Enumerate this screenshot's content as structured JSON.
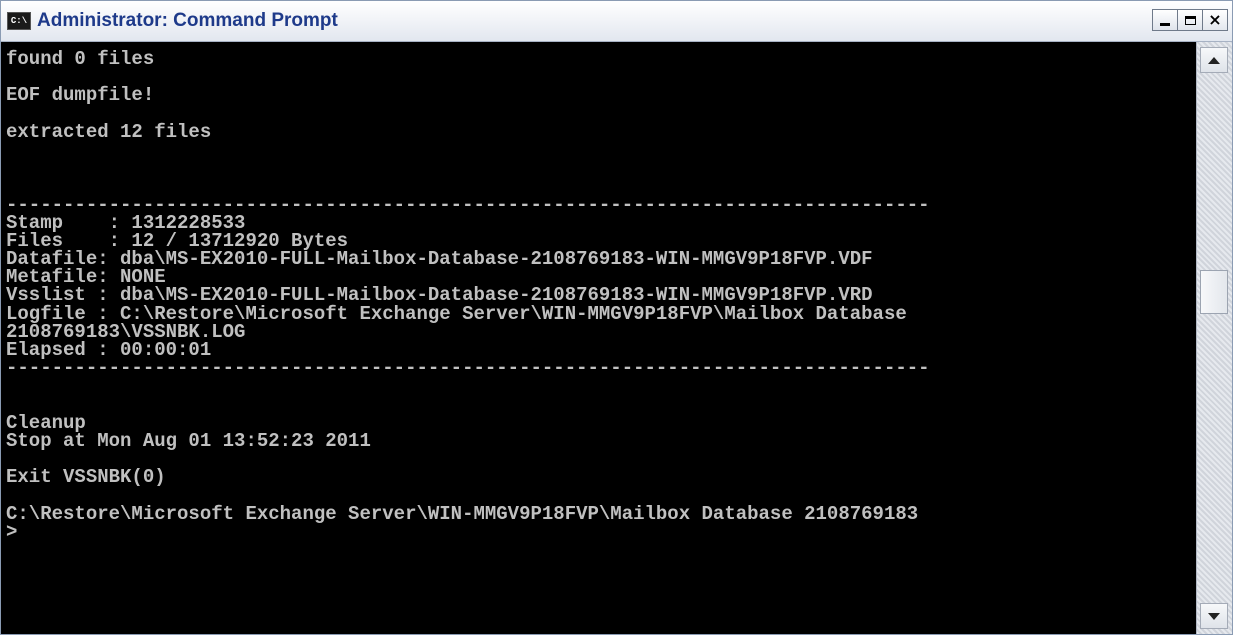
{
  "window": {
    "title": "Administrator: Command Prompt",
    "app_icon_text": "C:\\",
    "app_icon": "command-prompt-icon",
    "buttons": {
      "minimize": "minimize-icon",
      "maximize": "maximize-icon",
      "close": "close-icon",
      "close_glyph": "×"
    }
  },
  "console": {
    "lines": [
      "found 0 files",
      "",
      "EOF dumpfile!",
      "",
      "extracted 12 files",
      "",
      "",
      "",
      "---------------------------------------------------------------------------------",
      "Stamp    : 1312228533",
      "Files    : 12 / 13712920 Bytes",
      "Datafile: dba\\MS-EX2010-FULL-Mailbox-Database-2108769183-WIN-MMGV9P18FVP.VDF",
      "Metafile: NONE",
      "Vsslist : dba\\MS-EX2010-FULL-Mailbox-Database-2108769183-WIN-MMGV9P18FVP.VRD",
      "Logfile : C:\\Restore\\Microsoft Exchange Server\\WIN-MMGV9P18FVP\\Mailbox Database",
      "2108769183\\VSSNBK.LOG",
      "Elapsed : 00:00:01",
      "---------------------------------------------------------------------------------",
      "",
      "",
      "Cleanup",
      "Stop at Mon Aug 01 13:52:23 2011",
      "",
      "Exit VSSNBK(0)",
      "",
      "C:\\Restore\\Microsoft Exchange Server\\WIN-MMGV9P18FVP\\Mailbox Database 2108769183",
      ">"
    ],
    "foreground": "#c0c0c0",
    "background": "#000000"
  },
  "scrollbar": {
    "up_icon": "scroll-up-arrow-icon",
    "down_icon": "scroll-down-arrow-icon",
    "position_fraction": 0.4
  },
  "colors": {
    "title_text": "#1e3a8a",
    "frame": "#d6dbe4"
  }
}
